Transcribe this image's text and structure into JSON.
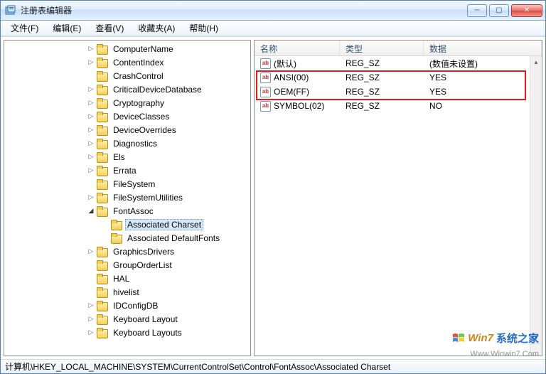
{
  "window": {
    "title": "注册表编辑器"
  },
  "menu": {
    "file": "文件(F)",
    "edit": "编辑(E)",
    "view": "查看(V)",
    "favorites": "收藏夹(A)",
    "help": "帮助(H)"
  },
  "columns": {
    "name": "名称",
    "type": "类型",
    "data": "数据"
  },
  "values": [
    {
      "name": "(默认)",
      "type": "REG_SZ",
      "data": "(数值未设置)"
    },
    {
      "name": "ANSI(00)",
      "type": "REG_SZ",
      "data": "YES"
    },
    {
      "name": "OEM(FF)",
      "type": "REG_SZ",
      "data": "YES"
    },
    {
      "name": "SYMBOL(02)",
      "type": "REG_SZ",
      "data": "NO"
    }
  ],
  "tree": {
    "nodes": [
      {
        "label": "ComputerName",
        "indent": 112,
        "toggle": "▷"
      },
      {
        "label": "ContentIndex",
        "indent": 112,
        "toggle": "▷"
      },
      {
        "label": "CrashControl",
        "indent": 112,
        "toggle": ""
      },
      {
        "label": "CriticalDeviceDatabase",
        "indent": 112,
        "toggle": "▷"
      },
      {
        "label": "Cryptography",
        "indent": 112,
        "toggle": "▷"
      },
      {
        "label": "DeviceClasses",
        "indent": 112,
        "toggle": "▷"
      },
      {
        "label": "DeviceOverrides",
        "indent": 112,
        "toggle": "▷"
      },
      {
        "label": "Diagnostics",
        "indent": 112,
        "toggle": "▷"
      },
      {
        "label": "Els",
        "indent": 112,
        "toggle": "▷"
      },
      {
        "label": "Errata",
        "indent": 112,
        "toggle": "▷"
      },
      {
        "label": "FileSystem",
        "indent": 112,
        "toggle": ""
      },
      {
        "label": "FileSystemUtilities",
        "indent": 112,
        "toggle": "▷"
      },
      {
        "label": "FontAssoc",
        "indent": 112,
        "toggle": "◢"
      },
      {
        "label": "Associated Charset",
        "indent": 132,
        "toggle": "",
        "selected": true
      },
      {
        "label": "Associated DefaultFonts",
        "indent": 132,
        "toggle": ""
      },
      {
        "label": "GraphicsDrivers",
        "indent": 112,
        "toggle": "▷"
      },
      {
        "label": "GroupOrderList",
        "indent": 112,
        "toggle": ""
      },
      {
        "label": "HAL",
        "indent": 112,
        "toggle": ""
      },
      {
        "label": "hivelist",
        "indent": 112,
        "toggle": ""
      },
      {
        "label": "IDConfigDB",
        "indent": 112,
        "toggle": "▷"
      },
      {
        "label": "Keyboard Layout",
        "indent": 112,
        "toggle": "▷"
      },
      {
        "label": "Keyboard Layouts",
        "indent": 112,
        "toggle": "▷"
      }
    ]
  },
  "statusbar": {
    "path": "计算机\\HKEY_LOCAL_MACHINE\\SYSTEM\\CurrentControlSet\\Control\\FontAssoc\\Associated Charset"
  },
  "watermark": {
    "brand1": "Win7",
    "brand2": "系统之家",
    "url": "Www.Winwin7.Com"
  },
  "icons": {
    "ab": "ab"
  }
}
